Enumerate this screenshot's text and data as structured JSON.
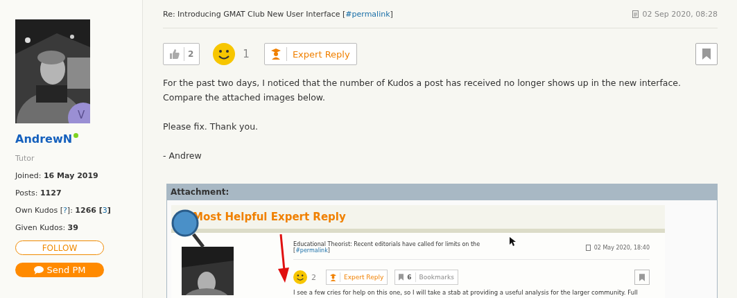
{
  "author": {
    "name": "AndrewN",
    "online": true,
    "badge": "V",
    "role": "Tutor",
    "stats": [
      [
        {
          "text": "Joined: "
        },
        {
          "text": "16 May 2019",
          "kind": "bold"
        }
      ],
      [
        {
          "text": "Posts: "
        },
        {
          "text": "1127",
          "kind": "bold"
        }
      ],
      [
        {
          "text": "Own Kudos ["
        },
        {
          "text": "?",
          "kind": "link"
        },
        {
          "text": "]: "
        },
        {
          "text": "1266 [",
          "kind": "bold"
        },
        {
          "text": "3",
          "kind": "link"
        },
        {
          "text": "]",
          "kind": "bold"
        }
      ],
      [
        {
          "text": "Given Kudos: "
        },
        {
          "text": "39",
          "kind": "bold"
        }
      ]
    ],
    "follow_button": "FOLLOW",
    "pm_button": "Send PM"
  },
  "post": {
    "title": [
      {
        "text": "Re: Introducing GMAT Club New User Interface ["
      },
      {
        "text": "#permalink",
        "kind": "link"
      },
      {
        "text": "]"
      }
    ],
    "date": "02 Sep 2020, 08:28",
    "kudos_count": "2",
    "smiley_count": "1",
    "expert_reply": "Expert Reply",
    "paragraphs": [
      "For the past two days, I noticed that the number of Kudos a post has received no longer shows up in the new interface. Compare the attached images below.",
      "Please fix. Thank you.",
      "- Andrew"
    ],
    "attachment": {
      "label": "Attachment:",
      "screenshot": {
        "heading": "Most Helpful Expert Reply",
        "title": "Educational Theorist: Recent editorials have called for limits on the",
        "title_link": [
          {
            "text": "["
          },
          {
            "text": "#permalink",
            "kind": "link"
          },
          {
            "text": "]"
          }
        ],
        "date": "02 May 2020, 18:40",
        "smiley_count": "2",
        "expert_reply": "Expert Reply",
        "bookmark_count": "6",
        "bookmarks": "Bookmarks",
        "body": "I see a few cries for help on this one, so I will take a stab at providing a useful analysis for the larger community. Full"
      }
    }
  }
}
